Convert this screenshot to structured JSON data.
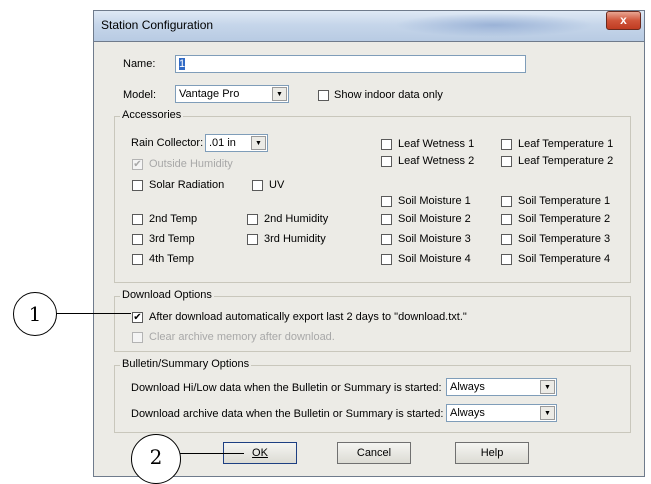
{
  "window": {
    "title": "Station Configuration",
    "close_glyph": "x"
  },
  "name": {
    "label": "Name:",
    "value": "1"
  },
  "model": {
    "label": "Model:",
    "value": "Vantage Pro",
    "show_indoor_label": "Show indoor data only"
  },
  "accessories": {
    "title": "Accessories",
    "rain_collector_label": "Rain Collector:",
    "rain_collector_value": ".01 in",
    "outside_humidity": "Outside Humidity",
    "solar_radiation": "Solar Radiation",
    "uv": "UV",
    "temp2": "2nd Temp",
    "temp3": "3rd Temp",
    "temp4": "4th Temp",
    "hum2": "2nd Humidity",
    "hum3": "3rd Humidity",
    "leaf_wetness_1": "Leaf Wetness 1",
    "leaf_wetness_2": "Leaf Wetness 2",
    "leaf_temp_1": "Leaf Temperature 1",
    "leaf_temp_2": "Leaf Temperature 2",
    "soil_moisture_1": "Soil Moisture 1",
    "soil_moisture_2": "Soil Moisture 2",
    "soil_moisture_3": "Soil Moisture 3",
    "soil_moisture_4": "Soil Moisture 4",
    "soil_temp_1": "Soil Temperature 1",
    "soil_temp_2": "Soil Temperature 2",
    "soil_temp_3": "Soil Temperature 3",
    "soil_temp_4": "Soil Temperature 4"
  },
  "download": {
    "title": "Download Options",
    "auto_export": "After download automatically export last 2 days to \"download.txt.\"",
    "clear_archive": "Clear archive memory after download."
  },
  "bulletin": {
    "title": "Bulletin/Summary Options",
    "hilow_label": "Download Hi/Low data when the Bulletin or Summary is started:",
    "hilow_value": "Always",
    "archive_label": "Download archive data when the Bulletin or Summary is started:",
    "archive_value": "Always"
  },
  "buttons": {
    "ok": "OK",
    "cancel": "Cancel",
    "help": "Help"
  },
  "callouts": {
    "one": "1",
    "two": "2"
  },
  "checkmark": "✔",
  "dropdown_arrow": "▼"
}
